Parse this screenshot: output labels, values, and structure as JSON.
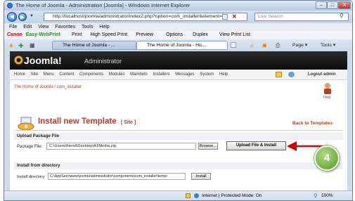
{
  "window": {
    "title": "The Home of Joomla - Administration [Joomla] - Windows Internet Explorer",
    "minimize_label": "–",
    "maximize_label": "□",
    "close_label": "X"
  },
  "address": {
    "url": "http://localhost/joomla/administrator/index2.php?option=com_installer&element=",
    "search_placeholder": "Live Search"
  },
  "menu": {
    "items": [
      "File",
      "Edit",
      "View",
      "Favorites",
      "Tools",
      "Help"
    ]
  },
  "toolbar": {
    "brand": "Canon",
    "easy_print": "Easy-WebPrint",
    "print": "Print",
    "high_speed_print": "High Speed Print",
    "preview": "Preview",
    "options": "Options",
    "duplex": "Duplex",
    "view_print_list": "View Print List"
  },
  "tabs": {
    "tab1": "The Home of Joomla - ...",
    "tab2": "The Home of Joomla - Ho...",
    "page_label": "Page",
    "tools_label": "Tools"
  },
  "joomla": {
    "logo": "Joomla!",
    "admin_label": "Administrator",
    "nav": [
      "Home",
      "Site",
      "Menu",
      "Content",
      "Components",
      "Modules",
      "Mambots",
      "Installers",
      "Messages",
      "System",
      "Help"
    ],
    "logout": "Logout admin",
    "breadcrumb": "The Home of Joomla / com_installer",
    "help_label": "Help",
    "page_title": "Install new Template",
    "page_title_suffix": "[ Site ]",
    "back_link": "Back to Templates"
  },
  "upload": {
    "section_title": "Upload Package File",
    "label": "Package File:",
    "file_value": "C:\\Users\\friend\\Desktop\\A1Media.zip",
    "browse_label": "Browse...",
    "upload_button": "Upload File & Install"
  },
  "directory": {
    "section_title": "Install from directory",
    "label": "Install directory:",
    "dir_value": "C:\\AppServ\\www\\joomla\\administrator\\components\\com_installer\\templ",
    "install_button": "Install"
  },
  "statusbar": {
    "zone": "Internet | Protected Mode: On",
    "zoom": "100%"
  },
  "callout": {
    "number": "4"
  },
  "colors": {
    "joomla_header": "#111111",
    "title_red": "#c0392b",
    "arrow_red": "#d40000",
    "callout_green": "#6fae3a"
  }
}
